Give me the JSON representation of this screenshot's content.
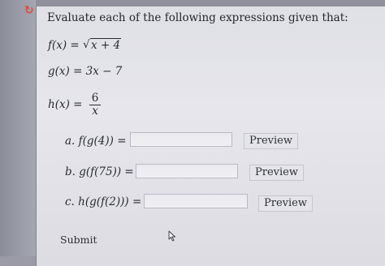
{
  "icons": {
    "refresh": "refresh-icon",
    "cursor": "mouse-cursor-icon"
  },
  "colors": {
    "refresh_icon": "#e04a3a"
  },
  "prompt": "Evaluate each of the following expressions given that:",
  "definitions": {
    "f": {
      "lhs": "f(x) = ",
      "radicand": "x + 4"
    },
    "g": {
      "text": "g(x) = 3x − 7"
    },
    "h": {
      "lhs": "h(x) = ",
      "numerator": "6",
      "denominator": "x"
    }
  },
  "questions": [
    {
      "label": "a. f(g(4)) = ",
      "value": "",
      "preview_label": "Preview"
    },
    {
      "label": "b. g(f(75)) = ",
      "value": "",
      "preview_label": "Preview"
    },
    {
      "label": "c. h(g(f(2))) = ",
      "value": "",
      "preview_label": "Preview"
    }
  ],
  "submit_label": "Submit"
}
